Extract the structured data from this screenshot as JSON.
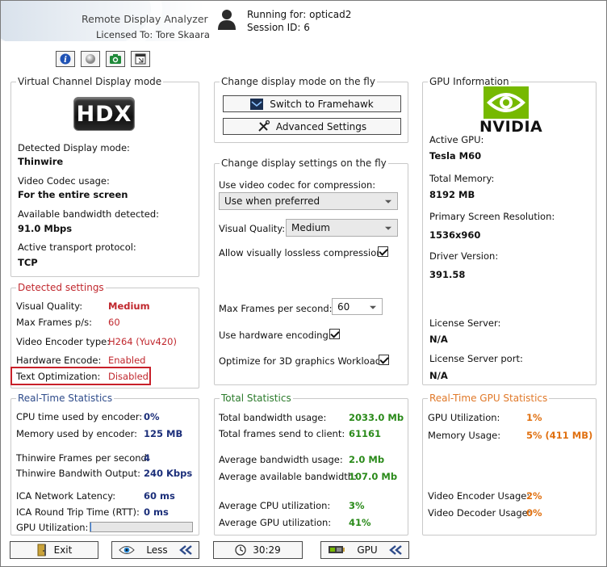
{
  "header": {
    "app_title": "Remote Display Analyzer",
    "licensed_to": "Licensed To: Tore Skaara",
    "running_for": "Running for: opticad2",
    "session_id": "Session ID: 6"
  },
  "toolbar_icons": [
    "info-icon",
    "ball-icon",
    "camera-icon",
    "window-icon"
  ],
  "virtual_channel": {
    "title": "Virtual Channel Display mode",
    "logo_text": "HDX",
    "detected_mode_label": "Detected Display mode:",
    "detected_mode_value": "Thinwire",
    "codec_label": "Video Codec usage:",
    "codec_value": "For the entire screen",
    "bandwidth_label": "Available bandwidth detected:",
    "bandwidth_value": "91.0 Mbps",
    "transport_label": "Active transport protocol:",
    "transport_value": "TCP"
  },
  "detected_settings": {
    "title": "Detected settings",
    "rows": [
      {
        "label": "Visual Quality:",
        "value": "Medium"
      },
      {
        "label": "Max Frames p/s:",
        "value": "60"
      },
      {
        "label": "Video Encoder type:",
        "value": "H264 (Yuv420)"
      },
      {
        "label": "Hardware Encode:",
        "value": "Enabled"
      },
      {
        "label": "Text Optimization:",
        "value": "Disabled"
      }
    ]
  },
  "change_mode": {
    "title": "Change display mode on the fly",
    "switch_label": "Switch to Framehawk",
    "advanced_label": "Advanced Settings"
  },
  "change_settings": {
    "title": "Change display settings on the fly",
    "codec_label": "Use video codec for compression:",
    "codec_selected": "Use when preferred",
    "quality_label": "Visual Quality:",
    "quality_selected": "Medium",
    "lossless_label": "Allow visually lossless compression:",
    "lossless_checked": true,
    "fps_label": "Max Frames per second:",
    "fps_selected": "60",
    "hw_label": "Use hardware encoding:",
    "hw_checked": true,
    "opt3d_label": "Optimize for 3D graphics Workload:",
    "opt3d_checked": true
  },
  "gpu_info": {
    "title": "GPU Information",
    "brand": "NVIDIA",
    "active_gpu_label": "Active GPU:",
    "active_gpu_value": "Tesla M60",
    "memory_label": "Total Memory:",
    "memory_value": "8192 MB",
    "resolution_label": "Primary Screen Resolution:",
    "resolution_value": "1536x960",
    "driver_label": "Driver Version:",
    "driver_value": "391.58",
    "license_server_label": "License Server:",
    "license_server_value": "N/A",
    "license_port_label": "License Server port:",
    "license_port_value": "N/A"
  },
  "realtime_stats": {
    "title": "Real-Time Statistics",
    "cpu_label": "CPU time used by encoder:",
    "cpu_value": "0%",
    "mem_label": "Memory used by encoder:",
    "mem_value": "125 MB",
    "tw_frames_label": "Thinwire Frames per second:",
    "tw_frames_value": "4",
    "tw_bw_label": "Thinwire Bandwith Output:",
    "tw_bw_value": "240 Kbps",
    "latency_label": "ICA Network Latency:",
    "latency_value": "60 ms",
    "rtt_label": "ICA Round Trip Time (RTT):",
    "rtt_value": "0 ms",
    "gpu_util_label": "GPU Utilization:",
    "gpu_util_fraction": 0.01
  },
  "total_stats": {
    "title": "Total Statistics",
    "bw_usage_label": "Total bandwidth usage:",
    "bw_usage_value": "2033.0 Mb",
    "frames_label": "Total frames send to client:",
    "frames_value": "61161",
    "avg_bw_label": "Average bandwidth usage:",
    "avg_bw_value": "2.0 Mb",
    "avg_avail_label": "Average available bandwidth:",
    "avg_avail_value": "107.0 Mb",
    "avg_cpu_label": "Average CPU utilization:",
    "avg_cpu_value": "3%",
    "avg_gpu_label": "Average GPU utilization:",
    "avg_gpu_value": "41%"
  },
  "realtime_gpu": {
    "title": "Real-Time GPU Statistics",
    "util_label": "GPU Utilization:",
    "util_value": "1%",
    "mem_label": "Memory Usage:",
    "mem_value": "5% (411 MB)",
    "enc_label": "Video Encoder Usage:",
    "enc_value": "2%",
    "dec_label": "Video Decoder Usage:",
    "dec_value": "0%"
  },
  "bottom_bar": {
    "exit_label": "Exit",
    "less_label": "Less",
    "timer_label": "30:29",
    "gpu_label": "GPU"
  }
}
